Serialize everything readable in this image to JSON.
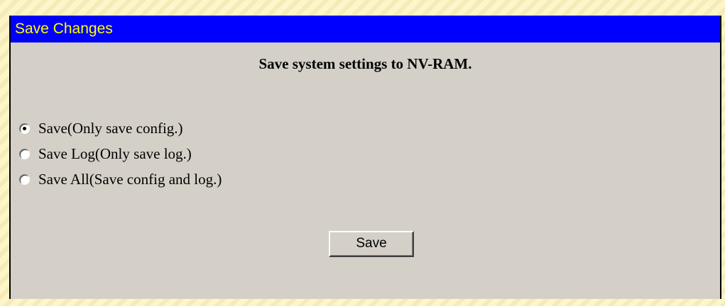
{
  "panel": {
    "title": "Save Changes",
    "heading": "Save system settings to NV-RAM."
  },
  "options": [
    {
      "label": "Save(Only save config.)",
      "checked": true
    },
    {
      "label": "Save Log(Only save log.)",
      "checked": false
    },
    {
      "label": "Save All(Save config and log.)",
      "checked": false
    }
  ],
  "actions": {
    "save_label": "Save"
  },
  "colors": {
    "title_bg": "#0000ff",
    "title_text": "#ffff00",
    "panel_bg": "#d4d0c8",
    "page_bg": "#fcf3c4"
  }
}
